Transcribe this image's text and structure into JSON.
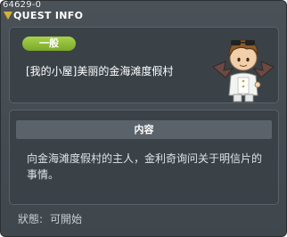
{
  "window": {
    "id_label": "64629-0",
    "title": "QUEST INFO"
  },
  "quest": {
    "category": "一般",
    "title": "[我的小屋]美丽的金海滩度假村",
    "npc_icon": "npc-portrait-icon"
  },
  "description": {
    "header": "内容",
    "text_line1": "向金海滩度假村的主人，金利奇询问关于明信片的",
    "text_line2": "事情。"
  },
  "status": {
    "label": "狀態:",
    "value": "可開始"
  },
  "colors": {
    "badge_green": "#8cbc36",
    "title_icon_gold": "#d4b03a",
    "panel_bg": "#3a4248"
  }
}
